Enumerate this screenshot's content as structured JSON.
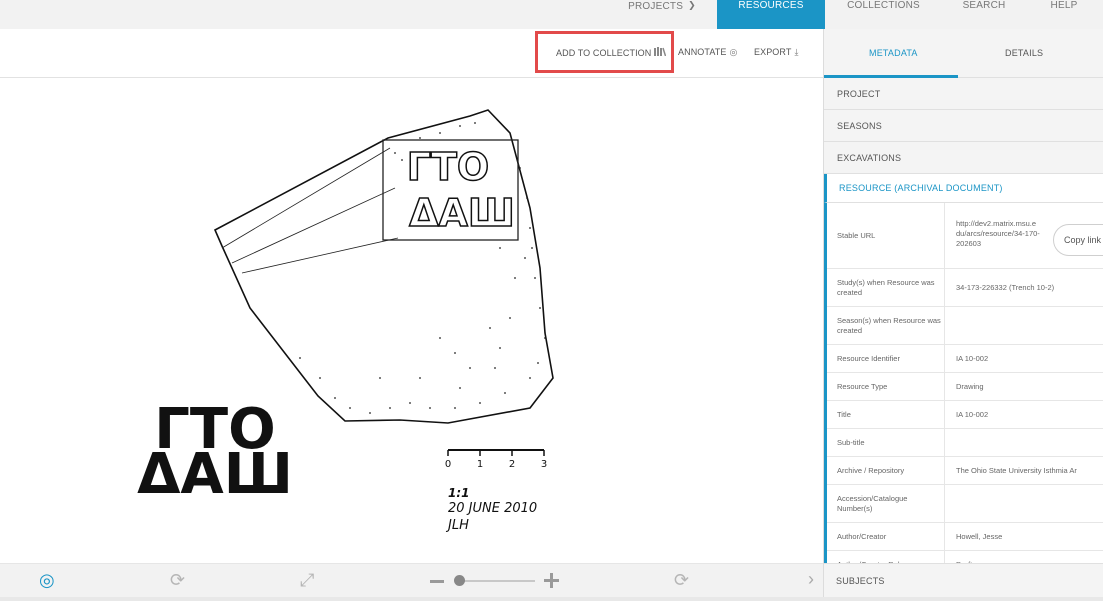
{
  "nav": {
    "projects": "PROJECTS",
    "resources": "RESOURCES",
    "collections": "COLLECTIONS",
    "search": "SEARCH",
    "help": "HELP"
  },
  "toolbar": {
    "add_to_collection": "ADD TO COLLECTION",
    "annotate": "ANNOTATE",
    "export": "EXPORT"
  },
  "drawing": {
    "scale_ticks": [
      "0",
      "1",
      "2",
      "3"
    ],
    "scale_label": "1:1",
    "date": "20 JUNE 2010",
    "initials": "JLH",
    "inscription_top": "ΓΤΟ",
    "inscription_bottom": "ΔΑШ"
  },
  "sidebar": {
    "tabs": {
      "metadata": "METADATA",
      "details": "DETAILS"
    },
    "sections": {
      "project": "PROJECT",
      "seasons": "SEASONS",
      "excavations": "EXCAVATIONS",
      "resource": "RESOURCE (ARCHIVAL DOCUMENT)",
      "subjects": "SUBJECTS"
    },
    "copy_link": "Copy link",
    "rows": [
      {
        "key": "Stable URL",
        "value": "http://dev2.matrix.msu.edu/arcs/resource/34-170-202603"
      },
      {
        "key": "Study(s) when Resource was created",
        "value": "34-173-226332 (Trench 10-2)"
      },
      {
        "key": "Season(s) when Resource was created",
        "value": ""
      },
      {
        "key": "Resource Identifier",
        "value": "IA 10-002"
      },
      {
        "key": "Resource Type",
        "value": "Drawing"
      },
      {
        "key": "Title",
        "value": "IA 10-002"
      },
      {
        "key": "Sub-title",
        "value": ""
      },
      {
        "key": "Archive / Repository",
        "value": "The Ohio State University Isthmia Ar"
      },
      {
        "key": "Accession/Catalogue Number(s)",
        "value": ""
      },
      {
        "key": "Author/Creator",
        "value": "Howell, Jesse"
      },
      {
        "key": "Author/Creator Role",
        "value": "Draftsman"
      }
    ]
  },
  "colors": {
    "accent": "#1b95c6",
    "highlight": "#e24a4a"
  }
}
